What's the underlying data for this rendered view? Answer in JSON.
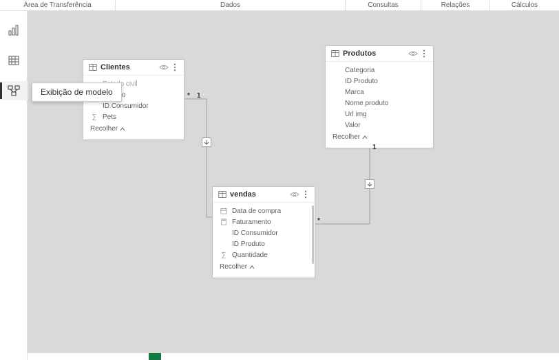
{
  "ribbon": {
    "groups": [
      "Área de Transferência",
      "Dados",
      "Consultas",
      "Relações",
      "Cálculos"
    ]
  },
  "leftNav": {
    "tooltip": "Exibição de modelo"
  },
  "tables": {
    "clientes": {
      "title": "Clientes",
      "fields": [
        {
          "label": "Estado civil",
          "kind": "dim"
        },
        {
          "label": "Gênero",
          "kind": ""
        },
        {
          "label": "ID Consumidor",
          "kind": ""
        },
        {
          "label": "Pets",
          "kind": "sum"
        }
      ],
      "collapse": "Recolher"
    },
    "produtos": {
      "title": "Produtos",
      "fields": [
        {
          "label": "Categoria"
        },
        {
          "label": "ID Produto"
        },
        {
          "label": "Marca"
        },
        {
          "label": "Nome produto"
        },
        {
          "label": "Url img"
        },
        {
          "label": "Valor"
        }
      ],
      "collapse": "Recolher"
    },
    "vendas": {
      "title": "vendas",
      "fields": [
        {
          "label": "Data de compra",
          "kind": "date"
        },
        {
          "label": "Faturamento",
          "kind": "calc"
        },
        {
          "label": "ID Consumidor",
          "kind": ""
        },
        {
          "label": "ID Produto",
          "kind": ""
        },
        {
          "label": "Quantidade",
          "kind": "sum"
        }
      ],
      "collapse": "Recolher"
    }
  },
  "cardinality": {
    "star": "*",
    "one": "1"
  }
}
